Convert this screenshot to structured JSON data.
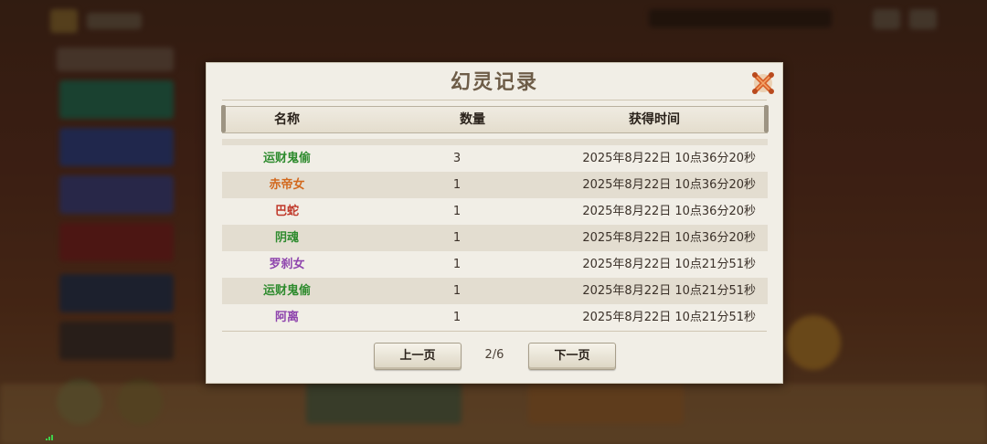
{
  "dialog": {
    "title": "幻灵记录",
    "close_icon": "close-x-icon",
    "columns": [
      "名称",
      "数量",
      "获得时间"
    ],
    "rows": [
      {
        "name": "运财鬼偷",
        "color": "#2e8b2e",
        "qty": "3",
        "time": "2025年8月22日  10点36分20秒"
      },
      {
        "name": "赤帝女",
        "color": "#d2691e",
        "qty": "1",
        "time": "2025年8月22日  10点36分20秒"
      },
      {
        "name": "巴蛇",
        "color": "#c0392b",
        "qty": "1",
        "time": "2025年8月22日  10点36分20秒"
      },
      {
        "name": "阴魂",
        "color": "#2e8b2e",
        "qty": "1",
        "time": "2025年8月22日  10点36分20秒"
      },
      {
        "name": "罗刹女",
        "color": "#8e44ad",
        "qty": "1",
        "time": "2025年8月22日  10点21分51秒"
      },
      {
        "name": "运财鬼偷",
        "color": "#2e8b2e",
        "qty": "1",
        "time": "2025年8月22日  10点21分51秒"
      },
      {
        "name": "阿离",
        "color": "#8e44ad",
        "qty": "1",
        "time": "2025年8月22日  10点21分51秒"
      }
    ],
    "prev_label": "上一页",
    "next_label": "下一页",
    "page_indicator": "2/6"
  },
  "colors": {
    "panel_bg": "#f1eee6",
    "alt_row": "#e3ddd0",
    "title_text": "#6d5c47",
    "close_icon": "#d9622b"
  }
}
